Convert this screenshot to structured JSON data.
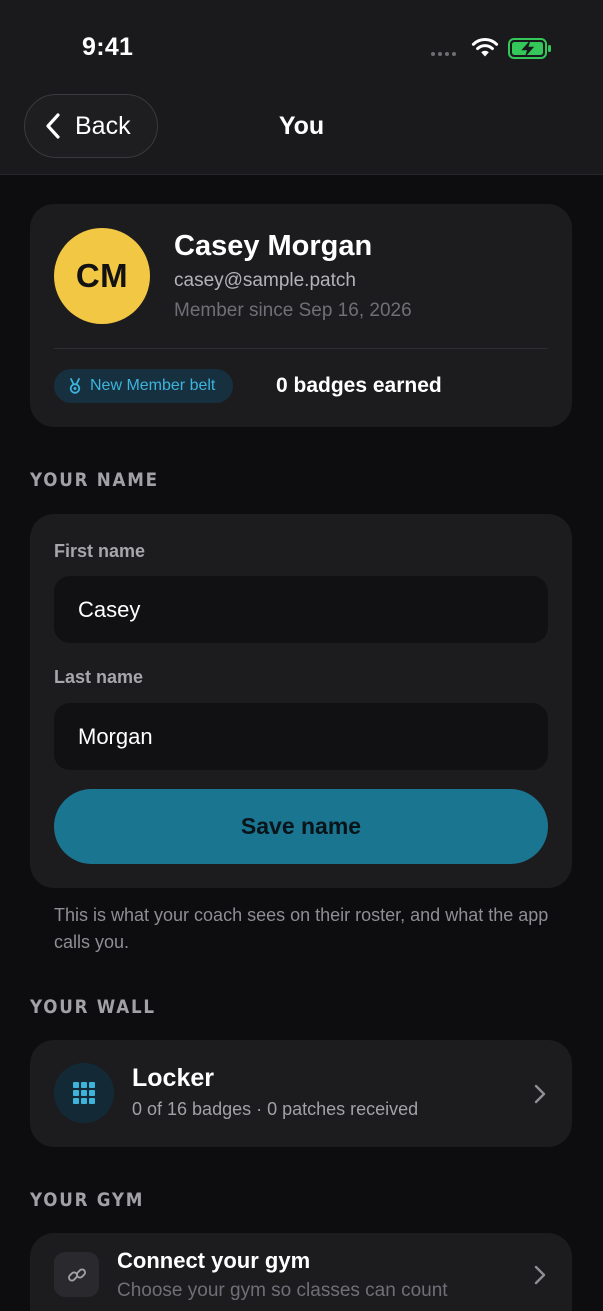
{
  "status_bar": {
    "time": "9:41"
  },
  "nav": {
    "back_label": "Back",
    "title": "You"
  },
  "profile": {
    "initials": "CM",
    "name": "Casey Morgan",
    "email": "casey@sample.patch",
    "member_since": "Member since Sep 16, 2026",
    "belt_label": "New Member belt",
    "badges_earned": "0 badges earned",
    "avatar_color": "#f2c744"
  },
  "name_section": {
    "header": "YOUR NAME",
    "first_name_label": "First name",
    "first_name_value": "Casey",
    "last_name_label": "Last name",
    "last_name_value": "Morgan",
    "save_label": "Save name",
    "helper_text": "This is what your coach sees on their roster, and what the app calls you."
  },
  "wall_section": {
    "header": "YOUR WALL",
    "locker_title": "Locker",
    "locker_subtitle": "0 of 16 badges · 0 patches received"
  },
  "gym_section": {
    "header": "YOUR GYM",
    "connect_title": "Connect your gym",
    "connect_subtitle": "Choose your gym so classes can count"
  },
  "colors": {
    "accent": "#1a7590",
    "accent_text": "#3cb4dc",
    "background": "#0d0d0f",
    "card": "#1c1c1f"
  },
  "icons": [
    "wifi-icon",
    "battery-charging-icon",
    "chevron-left-icon",
    "medal-icon",
    "grid-icon",
    "chevron-right-icon",
    "link-icon"
  ]
}
